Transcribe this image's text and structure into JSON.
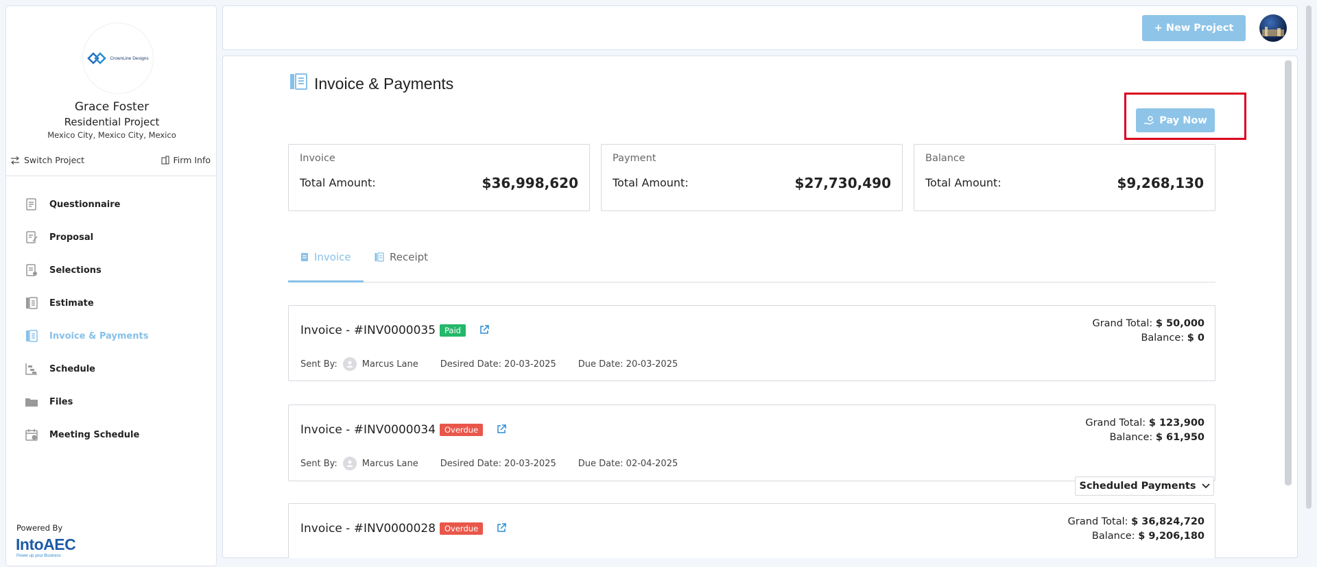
{
  "sidebar": {
    "firm_logo_text": "CrownLine Designs",
    "client_name": "Grace Foster",
    "project_name": "Residential Project",
    "location": "Mexico City, Mexico City, Mexico",
    "switch_project": "Switch Project",
    "firm_info": "Firm Info",
    "nav": [
      {
        "label": "Questionnaire",
        "icon": "questionnaire-icon"
      },
      {
        "label": "Proposal",
        "icon": "proposal-icon"
      },
      {
        "label": "Selections",
        "icon": "selections-icon"
      },
      {
        "label": "Estimate",
        "icon": "estimate-icon"
      },
      {
        "label": "Invoice & Payments",
        "icon": "invoice-icon",
        "active": true
      },
      {
        "label": "Schedule",
        "icon": "schedule-icon"
      },
      {
        "label": "Files",
        "icon": "folder-icon"
      },
      {
        "label": "Meeting Schedule",
        "icon": "calendar-icon"
      }
    ],
    "powered_by": "Powered By",
    "brand": "IntoAEC",
    "brand_tagline": "Power up your Business"
  },
  "topbar": {
    "new_project": "+ New Project"
  },
  "page": {
    "title": "Invoice & Payments",
    "pay_now": "Pay Now"
  },
  "summary": [
    {
      "label": "Invoice",
      "total_label": "Total Amount:",
      "value": "$36,998,620"
    },
    {
      "label": "Payment",
      "total_label": "Total Amount:",
      "value": "$27,730,490"
    },
    {
      "label": "Balance",
      "total_label": "Total Amount:",
      "value": "$9,268,130"
    }
  ],
  "tabs": [
    {
      "label": "Invoice",
      "active": true
    },
    {
      "label": "Receipt",
      "active": false
    }
  ],
  "invoices": [
    {
      "title": "Invoice - #INV0000035",
      "status": "Paid",
      "sent_by_label": "Sent By:",
      "sent_by": "Marcus Lane",
      "desired_date": "Desired Date: 20-03-2025",
      "due_date": "Due Date: 20-03-2025",
      "grand_total_label": "Grand Total:",
      "grand_total": "$ 50,000",
      "balance_label": "Balance:",
      "balance": "$ 0"
    },
    {
      "title": "Invoice - #INV0000034",
      "status": "Overdue",
      "sent_by_label": "Sent By:",
      "sent_by": "Marcus Lane",
      "desired_date": "Desired Date: 20-03-2025",
      "due_date": "Due Date: 02-04-2025",
      "grand_total_label": "Grand Total:",
      "grand_total": "$ 123,900",
      "balance_label": "Balance:",
      "balance": "$ 61,950",
      "scheduled_payments": "Scheduled Payments"
    },
    {
      "title": "Invoice - #INV0000028",
      "status": "Overdue",
      "grand_total_label": "Grand Total:",
      "grand_total": "$ 36,824,720",
      "balance_label": "Balance:",
      "balance": "$ 9,206,180"
    }
  ],
  "colors": {
    "accent": "#87c0e8",
    "button": "#8ec4e8",
    "paid": "#24b86a",
    "overdue": "#e9574b",
    "highlight": "#d8001c"
  }
}
